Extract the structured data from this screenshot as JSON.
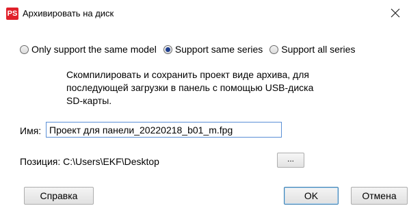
{
  "window": {
    "app_icon_text": "PS",
    "title": "Архивировать на диск",
    "close_icon": "close-icon"
  },
  "radio_group": {
    "options": [
      {
        "label": "Only support the same model",
        "checked": false
      },
      {
        "label": "Support same series",
        "checked": true
      },
      {
        "label": "Support all series",
        "checked": false
      }
    ]
  },
  "description": {
    "lines": [
      "Скомпилировать и сохранить проект виде архива, для",
      "последующей загрузки в панель с помощью USB-диска",
      "SD-карты."
    ]
  },
  "name_field": {
    "label": "Имя:",
    "value": "Проект для панели_20220218_b01_m.fpg"
  },
  "position": {
    "label": "Позиция: C:\\Users\\EKF\\Desktop",
    "browse_label": "..."
  },
  "buttons": {
    "help": "Справка",
    "ok": "OK",
    "cancel": "Отмена"
  },
  "colors": {
    "app_icon_bg": "#e0202a",
    "input_border": "#5a8fd6",
    "default_button_border": "#3c7fb1"
  }
}
